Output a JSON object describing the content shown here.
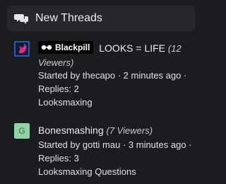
{
  "header": {
    "title": "New Threads",
    "icon": "chat-bubbles-icon"
  },
  "threads": [
    {
      "badge": "Blackpill",
      "title": "LOOKS = LIFE",
      "viewers_a": "(12",
      "viewers_b": "Viewers)",
      "started": "Started by thecapo · 2 minutes ago ·",
      "replies": "Replies: 2",
      "forum": "Looksmaxing",
      "avatar_colors": {
        "bg": "#0f1a3a",
        "fg": "#d63384"
      }
    },
    {
      "avatar_letter": "G",
      "title": "Bonesmashing",
      "viewers": "(7 Viewers)",
      "started": "Started by gotti mau · 3 minutes ago ·",
      "replies": "Replies: 3",
      "forum": "Looksmaxing Questions",
      "avatar_colors": {
        "bg": "#8fd3a6",
        "fg": "#2f6b45"
      }
    }
  ]
}
